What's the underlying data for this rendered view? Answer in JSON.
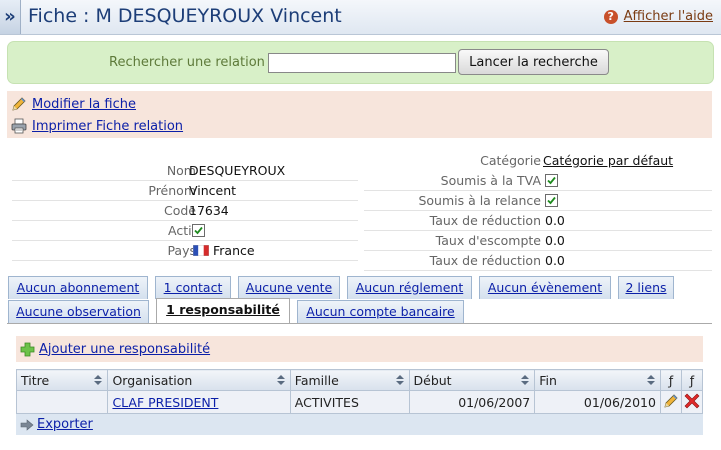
{
  "header": {
    "collapse_glyph": "»",
    "title": "Fiche : M DESQUEYROUX Vincent",
    "help_label": "Afficher l'aide"
  },
  "search": {
    "label": "Rechercher une relation",
    "value": "",
    "button": "Lancer la recherche"
  },
  "actions": {
    "edit": "Modifier la fiche",
    "print": "Imprimer Fiche relation"
  },
  "left_fields": [
    {
      "label": "Nom",
      "value": "DESQUEYROUX"
    },
    {
      "label": "Prénom",
      "value": "Vincent"
    },
    {
      "label": "Code",
      "value": "17634"
    },
    {
      "label": "Actif",
      "value": ""
    },
    {
      "label": "Pays",
      "value": "France"
    }
  ],
  "right_fields": [
    {
      "label": "Catégorie",
      "value": "Catégorie par défaut"
    },
    {
      "label": "Soumis à la TVA",
      "value": ""
    },
    {
      "label": "Soumis à la relance",
      "value": ""
    },
    {
      "label": "Taux de réduction",
      "value": "0.0"
    },
    {
      "label": "Taux d'escompte",
      "value": "0.0"
    },
    {
      "label": "Taux de réduction",
      "value": "0.0"
    }
  ],
  "tabs": {
    "row1": [
      "Aucun abonnement",
      "1 contact",
      "Aucune vente",
      "Aucun réglement",
      "Aucun évènement",
      "2 liens"
    ],
    "row2": [
      "Aucune observation",
      "1 responsabilité",
      "Aucun compte bancaire"
    ]
  },
  "panel": {
    "add_label": "Ajouter une responsabilité",
    "columns": [
      "Titre",
      "Organisation",
      "Famille",
      "Début",
      "Fin",
      "ƒ",
      "ƒ"
    ],
    "rows": [
      {
        "titre": "",
        "organisation": "CLAF PRESIDENT",
        "famille": "ACTIVITES",
        "debut": "01/06/2007",
        "fin": "01/06/2010"
      }
    ],
    "export_label": "Exporter"
  },
  "colors": {
    "title": "#1d3e78",
    "search_bg": "#d8f0c8",
    "action_bg": "#f7e5dc",
    "link": "#0b1fa8"
  }
}
